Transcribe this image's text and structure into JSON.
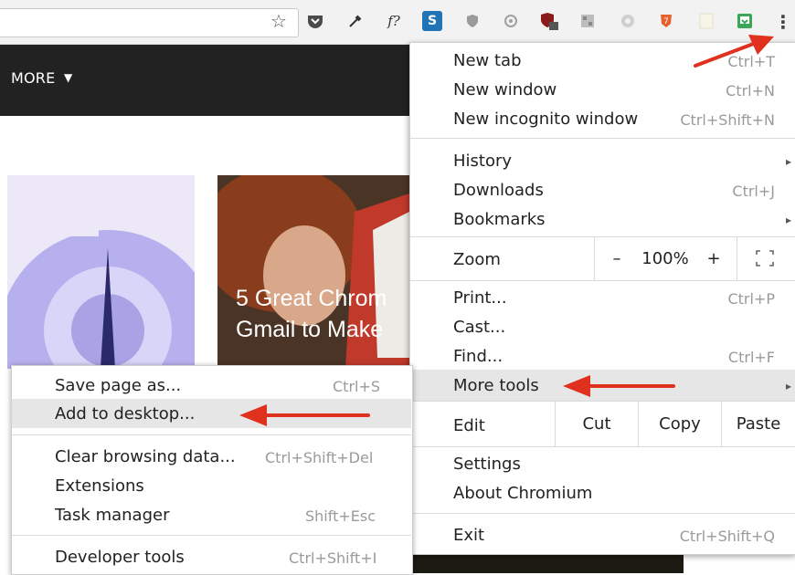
{
  "toolbar": {
    "bookmark_icon": "star-icon",
    "extensions": [
      "pocket-icon",
      "eyedropper-icon",
      "font-icon",
      "s-icon",
      "shield-icon",
      "mouse-icon",
      "ublock-icon",
      "qr-icon",
      "circle-icon",
      "brave-icon",
      "note-icon",
      "save-icon"
    ],
    "menu_icon": "kebab-menu-icon"
  },
  "page": {
    "nav_more": "MORE",
    "card_title_line1": "5 Great Chrom",
    "card_title_line2": "Gmail to Make"
  },
  "menu": {
    "new_tab": {
      "label": "New tab",
      "shortcut": "Ctrl+T"
    },
    "new_window": {
      "label": "New window",
      "shortcut": "Ctrl+N"
    },
    "new_incognito": {
      "label": "New incognito window",
      "shortcut": "Ctrl+Shift+N"
    },
    "history": {
      "label": "History"
    },
    "downloads": {
      "label": "Downloads",
      "shortcut": "Ctrl+J"
    },
    "bookmarks": {
      "label": "Bookmarks"
    },
    "zoom": {
      "label": "Zoom",
      "minus": "–",
      "level": "100%",
      "plus": "+"
    },
    "print": {
      "label": "Print...",
      "shortcut": "Ctrl+P"
    },
    "cast": {
      "label": "Cast..."
    },
    "find": {
      "label": "Find...",
      "shortcut": "Ctrl+F"
    },
    "more_tools": {
      "label": "More tools"
    },
    "edit": {
      "label": "Edit",
      "cut": "Cut",
      "copy": "Copy",
      "paste": "Paste"
    },
    "settings": {
      "label": "Settings"
    },
    "about": {
      "label": "About Chromium"
    },
    "exit": {
      "label": "Exit",
      "shortcut": "Ctrl+Shift+Q"
    }
  },
  "submenu": {
    "save_page": {
      "label": "Save page as...",
      "shortcut": "Ctrl+S"
    },
    "add_desktop": {
      "label": "Add to desktop..."
    },
    "clear_data": {
      "label": "Clear browsing data...",
      "shortcut": "Ctrl+Shift+Del"
    },
    "extensions": {
      "label": "Extensions"
    },
    "task_manager": {
      "label": "Task manager",
      "shortcut": "Shift+Esc"
    },
    "dev_tools": {
      "label": "Developer tools",
      "shortcut": "Ctrl+Shift+I"
    }
  },
  "colors": {
    "annotation_arrow": "#e0301e",
    "menu_highlight": "#e6e6e6",
    "navbar": "#222222"
  }
}
